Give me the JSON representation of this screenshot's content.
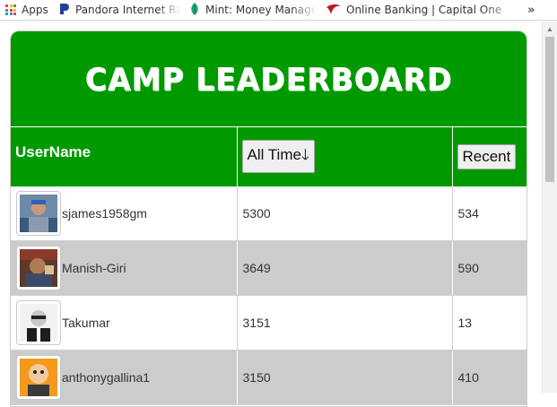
{
  "bookmarks": {
    "apps": "Apps",
    "pandora": "Pandora Internet Radio",
    "mint": "Mint: Money Manager",
    "bank": "Online Banking | Capital One",
    "more": "»",
    "apps_colors": [
      "#e94235",
      "#fbbc04",
      "#34a853",
      "#4285f4",
      "#e94235",
      "#fbbc04",
      "#34a853",
      "#4285f4",
      "#e94235"
    ]
  },
  "leaderboard": {
    "title": "CAMP LEADERBOARD",
    "columns": {
      "username": "UserName",
      "alltime": "All Time🡓",
      "recent": "Recent"
    },
    "rows": [
      {
        "username": "sjames1958gm",
        "alltime": "5300",
        "recent": "534"
      },
      {
        "username": "Manish-Giri",
        "alltime": "3649",
        "recent": "590"
      },
      {
        "username": "Takumar",
        "alltime": "3151",
        "recent": "13"
      },
      {
        "username": "anthonygallina1",
        "alltime": "3150",
        "recent": "410"
      }
    ]
  },
  "colors": {
    "header_green": "#009a00",
    "alt_row": "#cccccc"
  }
}
